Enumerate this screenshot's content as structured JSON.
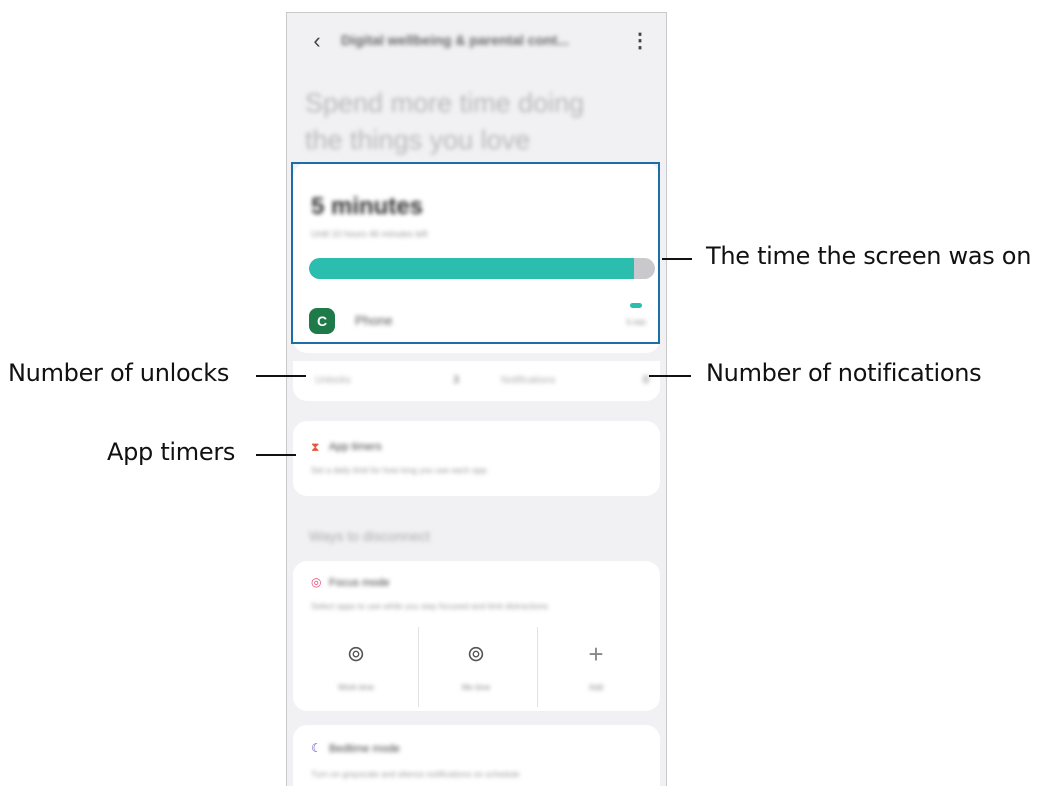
{
  "header": {
    "back_icon": "chevron-left-icon",
    "title": "Digital wellbeing & parental cont...",
    "more_icon": "more-vertical-icon"
  },
  "headline": "Spend more time doing the things you love",
  "screen_time": {
    "minutes": "5 minutes",
    "subtitle": "Until 10 hours 46 minutes left",
    "usage_fraction": 0.94,
    "app": {
      "name": "Phone",
      "icon_letter": "C",
      "time": "5 min"
    }
  },
  "stats": {
    "unlocks_label": "Unlocks",
    "unlocks_value": "3",
    "notifications_label": "Notifications",
    "notifications_value": "0"
  },
  "app_timers": {
    "icon": "hourglass-icon",
    "title": "App timers",
    "description": "Set a daily limit for how long you use each app."
  },
  "section_heading": "Ways to disconnect",
  "focus_mode": {
    "icon": "target-icon",
    "title": "Focus mode",
    "description": "Select apps to use while you stay focused and limit distractions",
    "tiles": [
      {
        "icon": "work-time-icon",
        "label": "Work time"
      },
      {
        "icon": "me-time-icon",
        "label": "Me time"
      },
      {
        "icon": "plus-icon",
        "label": "Add"
      }
    ]
  },
  "bedtime": {
    "icon": "moon-icon",
    "title": "Bedtime mode",
    "description": "Turn on grayscale and silence notifications on schedule"
  },
  "callouts": {
    "screen_time": "The time the screen was on",
    "unlocks": "Number of unlocks",
    "notifications": "Number of notifications",
    "app_timers": "App timers"
  },
  "colors": {
    "accent": "#2bbdae",
    "highlight_border": "#1b6fa8",
    "phone_icon_bg": "#1f7a4a",
    "timer_icon": "#e2583e",
    "focus_icon": "#e94c73",
    "moon_icon": "#5b3fc4"
  }
}
